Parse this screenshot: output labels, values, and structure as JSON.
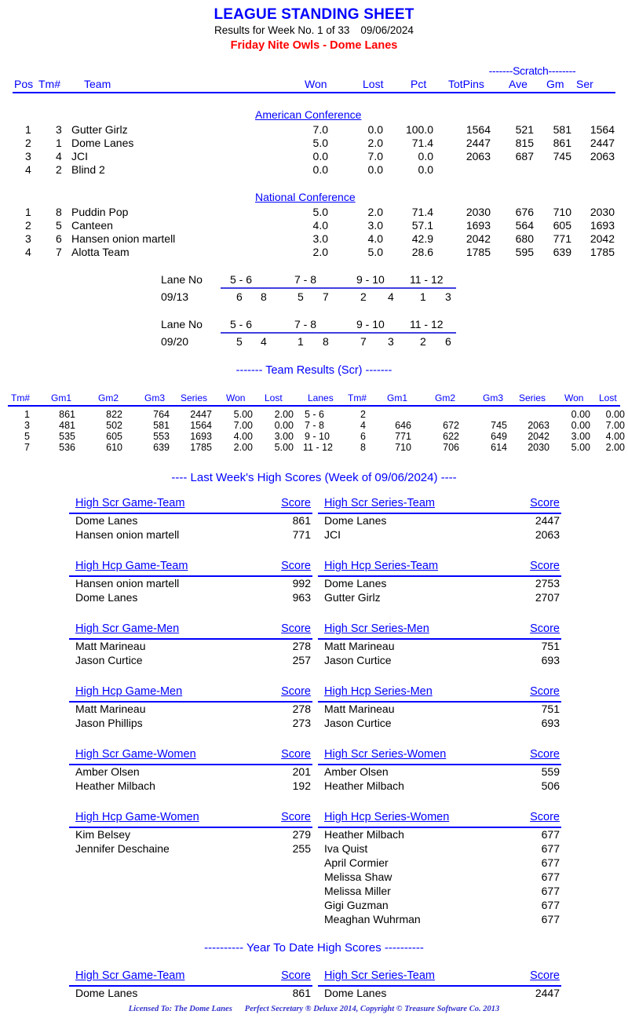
{
  "header": {
    "title": "LEAGUE STANDING SHEET",
    "results_for": "Results for Week No. 1 of 33",
    "date": "09/06/2024",
    "league": "Friday Nite Owls - Dome Lanes"
  },
  "standings": {
    "scratch_label": "-------Scratch--------",
    "columns": [
      "Pos",
      "Tm#",
      "Team",
      "Won",
      "Lost",
      "Pct",
      "TotPins",
      "Ave",
      "Gm",
      "Ser"
    ],
    "conferences": [
      {
        "name": "American Conference",
        "rows": [
          {
            "pos": "1",
            "tm": "3",
            "team": "Gutter Girlz",
            "won": "7.0",
            "lost": "0.0",
            "pct": "100.0",
            "totpins": "1564",
            "ave": "521",
            "gm": "581",
            "ser": "1564"
          },
          {
            "pos": "2",
            "tm": "1",
            "team": "Dome Lanes",
            "won": "5.0",
            "lost": "2.0",
            "pct": "71.4",
            "totpins": "2447",
            "ave": "815",
            "gm": "861",
            "ser": "2447"
          },
          {
            "pos": "3",
            "tm": "4",
            "team": "JCI",
            "won": "0.0",
            "lost": "7.0",
            "pct": "0.0",
            "totpins": "2063",
            "ave": "687",
            "gm": "745",
            "ser": "2063"
          },
          {
            "pos": "4",
            "tm": "2",
            "team": "Blind 2",
            "won": "0.0",
            "lost": "0.0",
            "pct": "0.0",
            "totpins": "",
            "ave": "",
            "gm": "",
            "ser": ""
          }
        ]
      },
      {
        "name": "National Conference",
        "rows": [
          {
            "pos": "1",
            "tm": "8",
            "team": "Puddin Pop",
            "won": "5.0",
            "lost": "2.0",
            "pct": "71.4",
            "totpins": "2030",
            "ave": "676",
            "gm": "710",
            "ser": "2030"
          },
          {
            "pos": "2",
            "tm": "5",
            "team": "Canteen",
            "won": "4.0",
            "lost": "3.0",
            "pct": "57.1",
            "totpins": "1693",
            "ave": "564",
            "gm": "605",
            "ser": "1693"
          },
          {
            "pos": "3",
            "tm": "6",
            "team": "Hansen onion martell",
            "won": "3.0",
            "lost": "4.0",
            "pct": "42.9",
            "totpins": "2042",
            "ave": "680",
            "gm": "771",
            "ser": "2042"
          },
          {
            "pos": "4",
            "tm": "7",
            "team": "Alotta Team",
            "won": "2.0",
            "lost": "5.0",
            "pct": "28.6",
            "totpins": "1785",
            "ave": "595",
            "gm": "639",
            "ser": "1785"
          }
        ]
      }
    ]
  },
  "lane_schedule": [
    {
      "label": "Lane No",
      "date": "09/13",
      "lanes": [
        "5 -  6",
        "7 -  8",
        "9 - 10",
        "11 - 12"
      ],
      "teams": [
        [
          "6",
          "8"
        ],
        [
          "5",
          "7"
        ],
        [
          "2",
          "4"
        ],
        [
          "1",
          "3"
        ]
      ]
    },
    {
      "label": "Lane No",
      "date": "09/20",
      "lanes": [
        "5 -  6",
        "7 -  8",
        "9 - 10",
        "11 - 12"
      ],
      "teams": [
        [
          "5",
          "4"
        ],
        [
          "1",
          "8"
        ],
        [
          "7",
          "3"
        ],
        [
          "2",
          "6"
        ]
      ]
    }
  ],
  "team_results": {
    "title": "------- Team Results (Scr) -------",
    "columns": [
      "Tm#",
      "Gm1",
      "Gm2",
      "Gm3",
      "Series",
      "Won",
      "Lost",
      "Lanes",
      "Tm#",
      "Gm1",
      "Gm2",
      "Gm3",
      "Series",
      "Won",
      "Lost"
    ],
    "rows": [
      {
        "tm": "1",
        "g1": "861",
        "g2": "822",
        "g3": "764",
        "series": "2447",
        "won": "5.00",
        "lost": "2.00",
        "lanes": "5  -   6",
        "tm2": "2",
        "g1b": "",
        "g2b": "",
        "g3b": "",
        "seriesb": "",
        "wonb": "0.00",
        "lostb": "0.00"
      },
      {
        "tm": "3",
        "g1": "481",
        "g2": "502",
        "g3": "581",
        "series": "1564",
        "won": "7.00",
        "lost": "0.00",
        "lanes": "7  -   8",
        "tm2": "4",
        "g1b": "646",
        "g2b": "672",
        "g3b": "745",
        "seriesb": "2063",
        "wonb": "0.00",
        "lostb": "7.00"
      },
      {
        "tm": "5",
        "g1": "535",
        "g2": "605",
        "g3": "553",
        "series": "1693",
        "won": "4.00",
        "lost": "3.00",
        "lanes": "9  -  10",
        "tm2": "6",
        "g1b": "771",
        "g2b": "622",
        "g3b": "649",
        "seriesb": "2042",
        "wonb": "3.00",
        "lostb": "4.00"
      },
      {
        "tm": "7",
        "g1": "536",
        "g2": "610",
        "g3": "639",
        "series": "1785",
        "won": "2.00",
        "lost": "5.00",
        "lanes": "11 -  12",
        "tm2": "8",
        "g1b": "710",
        "g2b": "706",
        "g3b": "614",
        "seriesb": "2030",
        "wonb": "5.00",
        "lostb": "2.00"
      }
    ]
  },
  "last_week": {
    "banner": "----  Last Week's High Scores   (Week of 09/06/2024)  ----",
    "score_label": "Score",
    "panels": [
      {
        "title": "High Scr Game-Team",
        "rows": [
          {
            "name": "Dome Lanes",
            "score": "861"
          },
          {
            "name": "Hansen onion martell",
            "score": "771"
          }
        ]
      },
      {
        "title": "High Scr Series-Team",
        "rows": [
          {
            "name": "Dome Lanes",
            "score": "2447"
          },
          {
            "name": "JCI",
            "score": "2063"
          }
        ]
      },
      {
        "title": "High Hcp Game-Team",
        "rows": [
          {
            "name": "Hansen onion martell",
            "score": "992"
          },
          {
            "name": "Dome Lanes",
            "score": "963"
          }
        ]
      },
      {
        "title": "High Hcp Series-Team",
        "rows": [
          {
            "name": "Dome Lanes",
            "score": "2753"
          },
          {
            "name": "Gutter Girlz",
            "score": "2707"
          }
        ]
      },
      {
        "title": "High Scr Game-Men",
        "rows": [
          {
            "name": "Matt Marineau",
            "score": "278"
          },
          {
            "name": "Jason Curtice",
            "score": "257"
          }
        ]
      },
      {
        "title": "High Scr Series-Men",
        "rows": [
          {
            "name": "Matt Marineau",
            "score": "751"
          },
          {
            "name": "Jason Curtice",
            "score": "693"
          }
        ]
      },
      {
        "title": "High Hcp Game-Men",
        "rows": [
          {
            "name": "Matt Marineau",
            "score": "278"
          },
          {
            "name": "Jason Phillips",
            "score": "273"
          }
        ]
      },
      {
        "title": "High Hcp Series-Men",
        "rows": [
          {
            "name": "Matt Marineau",
            "score": "751"
          },
          {
            "name": "Jason Curtice",
            "score": "693"
          }
        ]
      },
      {
        "title": "High Scr Game-Women",
        "rows": [
          {
            "name": "Amber Olsen",
            "score": "201"
          },
          {
            "name": "Heather Milbach",
            "score": "192"
          }
        ]
      },
      {
        "title": "High Scr Series-Women",
        "rows": [
          {
            "name": "Amber Olsen",
            "score": "559"
          },
          {
            "name": "Heather Milbach",
            "score": "506"
          }
        ]
      },
      {
        "title": "High Hcp Game-Women",
        "rows": [
          {
            "name": "Kim Belsey",
            "score": "279"
          },
          {
            "name": "Jennifer Deschaine",
            "score": "255"
          }
        ]
      },
      {
        "title": "High Hcp Series-Women",
        "rows": [
          {
            "name": "Heather Milbach",
            "score": "677"
          },
          {
            "name": "Iva Quist",
            "score": "677"
          },
          {
            "name": "April Cormier",
            "score": "677"
          },
          {
            "name": "Melissa Shaw",
            "score": "677"
          },
          {
            "name": "Melissa Miller",
            "score": "677"
          },
          {
            "name": "Gigi Guzman",
            "score": "677"
          },
          {
            "name": "Meaghan Wuhrman",
            "score": "677"
          }
        ]
      }
    ]
  },
  "year_to_date": {
    "banner": "---------- Year To Date High Scores ----------",
    "score_label": "Score",
    "panels": [
      {
        "title": "High Scr Game-Team",
        "rows": [
          {
            "name": "Dome Lanes",
            "score": "861"
          }
        ]
      },
      {
        "title": "High Scr Series-Team",
        "rows": [
          {
            "name": "Dome Lanes",
            "score": "2447"
          }
        ]
      }
    ]
  },
  "footer": {
    "licensed_to": "Licensed To: The Dome Lanes",
    "copyright": "Perfect Secretary ® Deluxe  2014, Copyright © Treasure Software Co. 2013"
  },
  "colors": {
    "heading_blue": "#0000ff",
    "league_red": "#ff0000",
    "text_black": "#000000",
    "footer_blue": "#3333cc"
  }
}
